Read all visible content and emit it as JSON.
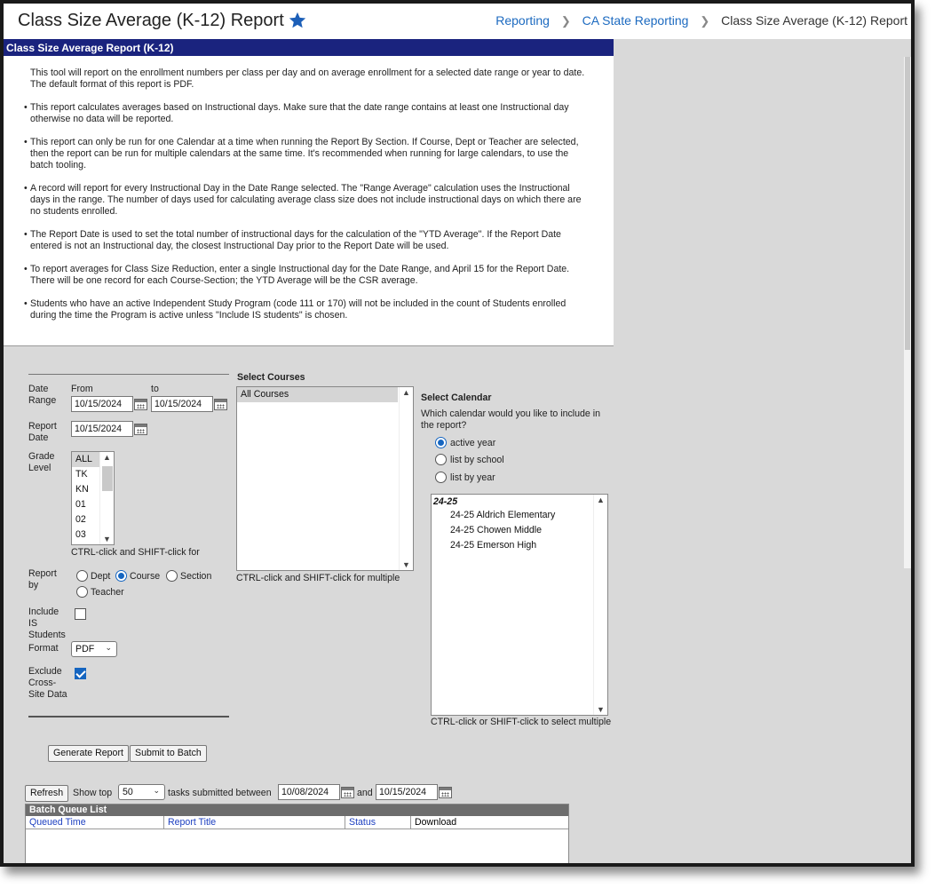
{
  "header": {
    "title": "Class Size Average (K-12) Report",
    "breadcrumbs": [
      "Reporting",
      "CA State Reporting",
      "Class Size Average (K-12) Report"
    ]
  },
  "info": {
    "title": "Class Size Average Report (K-12)",
    "intro": "This tool will report on the enrollment numbers per class per day and on average enrollment for a selected date range or year to date. The default format of this report is PDF.",
    "bullets": [
      "This report calculates averages based on Instructional days. Make sure that the date range contains at least one Instructional day otherwise no data will be reported.",
      "This report can only be run for one Calendar at a time when running the Report By Section. If Course, Dept or Teacher are selected, then the report can be run for multiple calendars at the same time. It's recommended when running for large calendars, to use the batch tooling.",
      "A record will report for every Instructional Day in the Date Range selected. The \"Range Average\" calculation uses the Instructional days in the range. The number of days used for calculating average class size does not include instructional days on which there are no students enrolled.",
      "The Report Date is used to set the total number of instructional days for the calculation of the \"YTD Average\". If the Report Date entered is not an Instructional day, the closest Instructional Day prior to the Report Date will be used.",
      "To report averages for Class Size Reduction, enter a single Instructional day for the Date Range, and April 15 for the Report Date. There will be one record for each Course-Section; the YTD Average will be the CSR average.",
      "Students who have an active Independent Study Program (code 111 or 170) will not be included in the count of Students enrolled during the time the Program is active unless \"Include IS students\" is chosen."
    ]
  },
  "form": {
    "date_range_label_1": "Date",
    "date_range_label_2": "Range",
    "from_label": "From",
    "to_label": "to",
    "from_value": "10/15/2024",
    "to_value": "10/15/2024",
    "report_date_label_1": "Report",
    "report_date_label_2": "Date",
    "report_date_value": "10/15/2024",
    "grade_label_1": "Grade",
    "grade_label_2": "Level",
    "grades": [
      "ALL",
      "TK",
      "KN",
      "01",
      "02",
      "03"
    ],
    "grade_hint": "CTRL-click and SHIFT-click for",
    "report_by_label_1": "Report",
    "report_by_label_2": "by",
    "report_by_options": [
      "Dept",
      "Course",
      "Section",
      "Teacher"
    ],
    "report_by_selected": "Course",
    "include_is_label": [
      "Include",
      "IS",
      "Students"
    ],
    "format_label": "Format",
    "format_value": "PDF",
    "exclude_label": [
      "Exclude",
      "Cross-",
      "Site Data"
    ],
    "courses_title": "Select Courses",
    "courses": [
      "All Courses"
    ],
    "courses_hint": "CTRL-click and SHIFT-click for multiple",
    "calendar_title": "Select Calendar",
    "calendar_question": "Which calendar would you like to include in the report?",
    "calendar_options": [
      "active year",
      "list by school",
      "list by year"
    ],
    "calendar_group": "24-25",
    "calendars": [
      "24-25 Aldrich Elementary",
      "24-25 Chowen Middle",
      "24-25 Emerson High"
    ],
    "calendar_hint": "CTRL-click or SHIFT-click to select multiple",
    "generate_button": "Generate Report",
    "batch_button": "Submit to Batch"
  },
  "batch": {
    "refresh_button": "Refresh",
    "show_top_label": "Show top",
    "show_top_value": "50",
    "between_label": "tasks submitted between",
    "start_date": "10/08/2024",
    "and_label": "and",
    "end_date": "10/15/2024",
    "list_title": "Batch Queue List",
    "columns": [
      "Queued Time",
      "Report Title",
      "Status",
      "Download"
    ]
  },
  "colors": {
    "accent": "#1565c0",
    "info_header": "#1a237e",
    "link": "#1c6ac0"
  }
}
